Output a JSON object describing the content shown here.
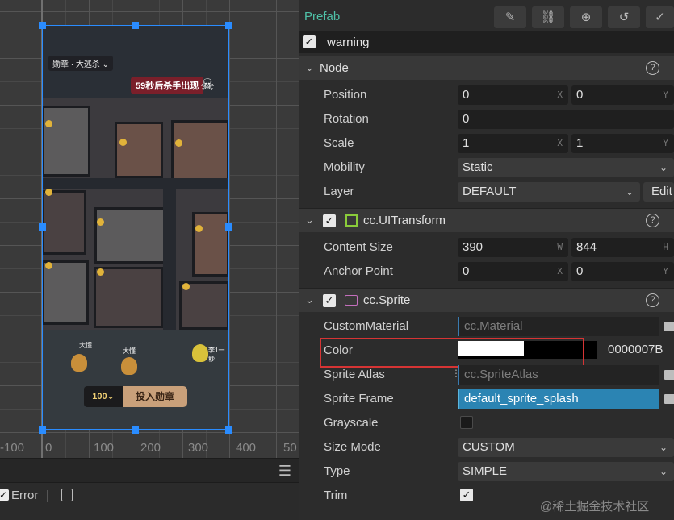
{
  "scene": {
    "ruler_labels": [
      "-100",
      "0",
      "100",
      "200",
      "300",
      "400",
      "50"
    ],
    "game": {
      "rank_label": "勋章 · 大逃杀 ⌄",
      "countdown": "59秒后杀手出现",
      "coin_count": "100⌄",
      "deposit_button": "投入勋章",
      "characters": [
        "大懂",
        "大懂",
        "李1一秒"
      ]
    }
  },
  "console": {
    "menu_icon": "hamburger-menu-icon",
    "error_label": "Error"
  },
  "inspector": {
    "prefab_label": "Prefab",
    "toolbar_icons": [
      "edit-icon",
      "unlink-icon",
      "locate-icon",
      "revert-icon",
      "apply-icon"
    ],
    "node_name": "warning",
    "node_section": {
      "title": "Node",
      "position": {
        "label": "Position",
        "x": "0",
        "y": "0",
        "x_unit": "X",
        "y_unit": "Y"
      },
      "rotation": {
        "label": "Rotation",
        "value": "0"
      },
      "scale": {
        "label": "Scale",
        "x": "1",
        "y": "1",
        "x_unit": "X",
        "y_unit": "Y"
      },
      "mobility": {
        "label": "Mobility",
        "value": "Static"
      },
      "layer": {
        "label": "Layer",
        "value": "DEFAULT",
        "edit_label": "Edit"
      }
    },
    "uitransform": {
      "title": "cc.UITransform",
      "content_size": {
        "label": "Content Size",
        "w": "390",
        "h": "844",
        "w_unit": "W",
        "h_unit": "H"
      },
      "anchor_point": {
        "label": "Anchor Point",
        "x": "0",
        "y": "0",
        "x_unit": "X",
        "y_unit": "Y"
      }
    },
    "sprite": {
      "title": "cc.Sprite",
      "custom_material": {
        "label": "CustomMaterial",
        "value": "cc.Material"
      },
      "color": {
        "label": "Color",
        "hex": "0000007B",
        "swatch": "#000000"
      },
      "sprite_atlas": {
        "label": "Sprite Atlas",
        "value": "cc.SpriteAtlas"
      },
      "sprite_frame": {
        "label": "Sprite Frame",
        "value": "default_sprite_splash"
      },
      "grayscale": {
        "label": "Grayscale",
        "checked": false
      },
      "size_mode": {
        "label": "Size Mode",
        "value": "CUSTOM"
      },
      "type": {
        "label": "Type",
        "value": "SIMPLE"
      },
      "trim": {
        "label": "Trim",
        "checked": true
      }
    },
    "watermark": "@稀土掘金技术社区"
  },
  "colors": {
    "accent_blue": "#2a8cff",
    "prefab_green": "#4fc2a8",
    "highlight_red": "#d63434",
    "asset_selected": "#2b84b3"
  }
}
